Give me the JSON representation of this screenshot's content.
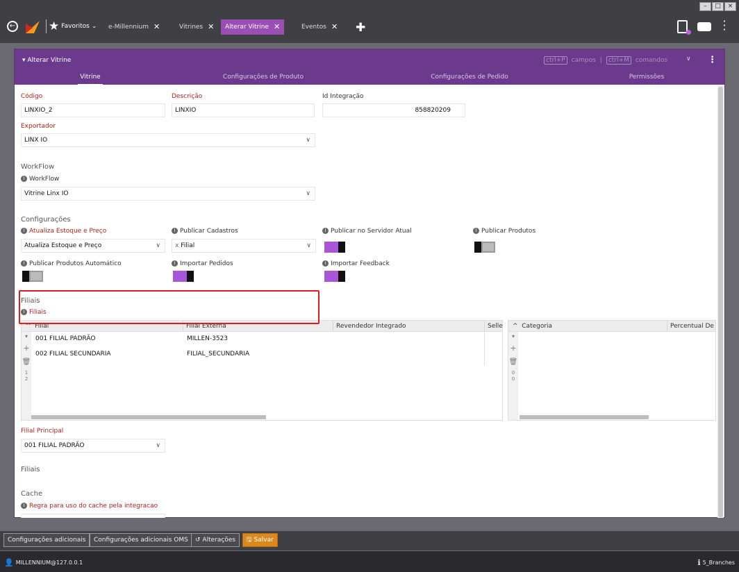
{
  "window": {
    "controls": [
      "–",
      "□",
      "×"
    ]
  },
  "topnav": {
    "favorites": "Favoritos",
    "tabs": [
      {
        "label": "e-Millennium",
        "active": false
      },
      {
        "label": "Vitrines",
        "active": false
      },
      {
        "label": "Alterar Vitrine",
        "active": true
      },
      {
        "label": "Eventos",
        "active": false
      }
    ]
  },
  "modal": {
    "title": "Alterar Vitrine",
    "shortcut_fields_key": "ctrl+P",
    "shortcut_fields_label": "campos",
    "shortcut_cmd_key": "ctrl+M",
    "shortcut_cmd_label": "comandos",
    "tabs": [
      "Vitrine",
      "Configurações de Produto",
      "Configurações de Pedido",
      "Permissões"
    ]
  },
  "form": {
    "codigo": {
      "label": "Código",
      "value": "LINXIO_2"
    },
    "descricao": {
      "label": "Descrição",
      "value": "LINXIO"
    },
    "id_integracao": {
      "label": "Id Integração",
      "value": "858820209"
    },
    "exportador": {
      "label": "Exportador",
      "value": "LINX IO"
    },
    "workflow_section": "WorkFlow",
    "workflow": {
      "label": "WorkFlow",
      "value": "Vitrine Linx IO"
    },
    "config_section": "Configurações",
    "atualiza": {
      "label": "Atualiza Estoque e Preço",
      "value": "Atualiza Estoque e Preço"
    },
    "publicar_cadastros": {
      "label": "Publicar Cadastros",
      "tag_x": "x",
      "tag": "Filial"
    },
    "publicar_servidor": {
      "label": "Publicar no Servidor Atual",
      "on": true
    },
    "publicar_produtos": {
      "label": "Publicar Produtos",
      "on": false
    },
    "publicar_auto": {
      "label": "Publicar Produtos Automático",
      "on": false
    },
    "importar_pedidos": {
      "label": "Importar Pedidos",
      "on": true
    },
    "importar_feedback": {
      "label": "Importar Feedback",
      "on": true
    },
    "filiais_section": "Filiais",
    "filiais_label": "Filiais",
    "grid1": {
      "columns": [
        "Filial",
        "Filial Externa",
        "Revendedor Integrado",
        "Selle"
      ],
      "rows": [
        [
          "001 FILIAL PADRÃO",
          "MILLEN-3523"
        ],
        [
          "002 FILIAL SECUNDARIA",
          "FILIAL_SECUNDARIA"
        ]
      ],
      "page_current": "1",
      "page_total": "2"
    },
    "grid2": {
      "columns": [
        "Categoria",
        "Percentual De"
      ],
      "page_current": "0",
      "page_total": "0"
    },
    "filial_principal": {
      "label": "Filial Principal",
      "value": "001 FILIAL PADRÃO"
    },
    "filiais_section2": "Filiais",
    "cache_section": "Cache",
    "cache_label": "Regra para uso do cache pela integracao"
  },
  "bottom": {
    "b1": "Configurações adicionais",
    "b2": "Configurações adicionais OMS",
    "b3": "Alterações",
    "b4": "Salvar"
  },
  "status": {
    "user": "MILLENNIUM@127.0.0.1",
    "branches": "5_Branches"
  },
  "colors": {
    "accent": "#6b3a8c",
    "toggle_on": "#a855d8",
    "save": "#d9891e",
    "required": "#b5211a"
  }
}
